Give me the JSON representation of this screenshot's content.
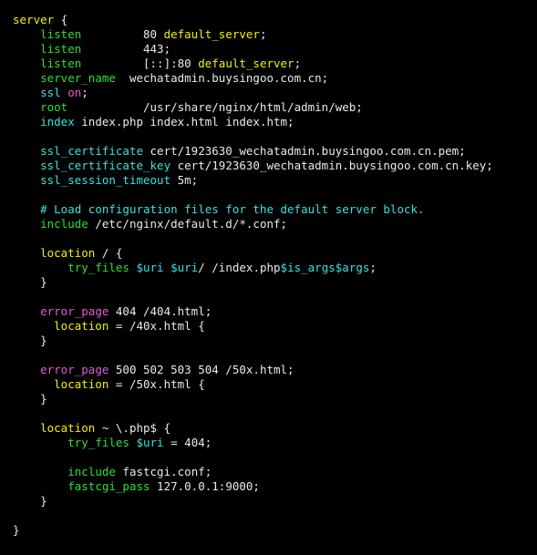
{
  "terminal": {
    "title": "nginx-configuration-file",
    "background_color": "#000000",
    "colors": {
      "plain": "#d8d8d8",
      "yellow": "#f2f200",
      "green": "#2ee02e",
      "cyan": "#3ce0e0",
      "magenta": "#e85ad8",
      "white": "#eaeaea"
    },
    "lines": [
      {
        "id": "line-server-open",
        "tokens": [
          {
            "text": "server",
            "color": "yellow"
          },
          {
            "text": " {",
            "color": "white"
          }
        ]
      },
      {
        "id": "line-listen-80",
        "tokens": [
          {
            "text": "    ",
            "color": "plain"
          },
          {
            "text": "listen",
            "color": "green"
          },
          {
            "text": "         ",
            "color": "plain"
          },
          {
            "text": "80 ",
            "color": "white"
          },
          {
            "text": "default_server",
            "color": "yellow"
          },
          {
            "text": ";",
            "color": "white"
          }
        ]
      },
      {
        "id": "line-listen-443",
        "tokens": [
          {
            "text": "    ",
            "color": "plain"
          },
          {
            "text": "listen",
            "color": "green"
          },
          {
            "text": "         ",
            "color": "plain"
          },
          {
            "text": "443;",
            "color": "white"
          }
        ]
      },
      {
        "id": "line-listen-ipv6",
        "tokens": [
          {
            "text": "    ",
            "color": "plain"
          },
          {
            "text": "listen",
            "color": "green"
          },
          {
            "text": "         ",
            "color": "plain"
          },
          {
            "text": "[::]:80 ",
            "color": "white"
          },
          {
            "text": "default_server",
            "color": "yellow"
          },
          {
            "text": ";",
            "color": "white"
          }
        ]
      },
      {
        "id": "line-server-name",
        "tokens": [
          {
            "text": "    ",
            "color": "plain"
          },
          {
            "text": "server_name",
            "color": "green"
          },
          {
            "text": "  wechatadmin.buysingoo.com.cn;",
            "color": "white"
          }
        ]
      },
      {
        "id": "line-ssl-on",
        "tokens": [
          {
            "text": "    ",
            "color": "plain"
          },
          {
            "text": "ssl",
            "color": "cyan"
          },
          {
            "text": " ",
            "color": "plain"
          },
          {
            "text": "on",
            "color": "magenta"
          },
          {
            "text": ";",
            "color": "white"
          }
        ]
      },
      {
        "id": "line-root",
        "tokens": [
          {
            "text": "    ",
            "color": "plain"
          },
          {
            "text": "root",
            "color": "green"
          },
          {
            "text": "           /usr/share/nginx/html/admin/web;",
            "color": "white"
          }
        ]
      },
      {
        "id": "line-index",
        "tokens": [
          {
            "text": "    ",
            "color": "plain"
          },
          {
            "text": "index",
            "color": "cyan"
          },
          {
            "text": " index.php index.html index.htm;",
            "color": "white"
          }
        ]
      },
      {
        "id": "line-blank-1",
        "tokens": []
      },
      {
        "id": "line-ssl-certificate",
        "tokens": [
          {
            "text": "    ",
            "color": "plain"
          },
          {
            "text": "ssl_certificate",
            "color": "cyan"
          },
          {
            "text": " cert/1923630_wechatadmin.buysingoo.com.cn.pem;",
            "color": "white"
          }
        ]
      },
      {
        "id": "line-ssl-certificate-key",
        "tokens": [
          {
            "text": "    ",
            "color": "plain"
          },
          {
            "text": "ssl_certificate_key",
            "color": "cyan"
          },
          {
            "text": " cert/1923630_wechatadmin.buysingoo.com.cn.key;",
            "color": "white"
          }
        ]
      },
      {
        "id": "line-ssl-session-timeout",
        "tokens": [
          {
            "text": "    ",
            "color": "plain"
          },
          {
            "text": "ssl_session_timeout",
            "color": "cyan"
          },
          {
            "text": " 5m;",
            "color": "white"
          }
        ]
      },
      {
        "id": "line-blank-2",
        "tokens": []
      },
      {
        "id": "line-comment-load-config",
        "tokens": [
          {
            "text": "    ",
            "color": "plain"
          },
          {
            "text": "# Load configuration files for the default server block.",
            "color": "cyan"
          }
        ]
      },
      {
        "id": "line-include-default-d",
        "tokens": [
          {
            "text": "    ",
            "color": "plain"
          },
          {
            "text": "include",
            "color": "green"
          },
          {
            "text": " /etc/nginx/default.d/*.conf;",
            "color": "white"
          }
        ]
      },
      {
        "id": "line-blank-3",
        "tokens": []
      },
      {
        "id": "line-location-root-open",
        "tokens": [
          {
            "text": "    ",
            "color": "plain"
          },
          {
            "text": "location",
            "color": "yellow"
          },
          {
            "text": " / {",
            "color": "white"
          }
        ]
      },
      {
        "id": "line-try-files-root",
        "tokens": [
          {
            "text": "        ",
            "color": "plain"
          },
          {
            "text": "try_files",
            "color": "green"
          },
          {
            "text": " ",
            "color": "plain"
          },
          {
            "text": "$uri",
            "color": "cyan"
          },
          {
            "text": " ",
            "color": "plain"
          },
          {
            "text": "$uri",
            "color": "cyan"
          },
          {
            "text": "/ /index.php",
            "color": "white"
          },
          {
            "text": "$is_args",
            "color": "cyan"
          },
          {
            "text": "$args",
            "color": "cyan"
          },
          {
            "text": ";",
            "color": "white"
          }
        ]
      },
      {
        "id": "line-location-root-close",
        "tokens": [
          {
            "text": "    }",
            "color": "white"
          }
        ]
      },
      {
        "id": "line-blank-4",
        "tokens": []
      },
      {
        "id": "line-error-page-404",
        "tokens": [
          {
            "text": "    ",
            "color": "plain"
          },
          {
            "text": "error_page",
            "color": "magenta"
          },
          {
            "text": " 404 /404.html;",
            "color": "white"
          }
        ]
      },
      {
        "id": "line-location-40x-open",
        "tokens": [
          {
            "text": "      ",
            "color": "plain"
          },
          {
            "text": "location",
            "color": "yellow"
          },
          {
            "text": " = /40x.html {",
            "color": "white"
          }
        ]
      },
      {
        "id": "line-location-40x-close",
        "tokens": [
          {
            "text": "    }",
            "color": "white"
          }
        ]
      },
      {
        "id": "line-blank-5",
        "tokens": []
      },
      {
        "id": "line-error-page-50x",
        "tokens": [
          {
            "text": "    ",
            "color": "plain"
          },
          {
            "text": "error_page",
            "color": "magenta"
          },
          {
            "text": " 500 502 503 504 /50x.html;",
            "color": "white"
          }
        ]
      },
      {
        "id": "line-location-50x-open",
        "tokens": [
          {
            "text": "      ",
            "color": "plain"
          },
          {
            "text": "location",
            "color": "yellow"
          },
          {
            "text": " = /50x.html {",
            "color": "white"
          }
        ]
      },
      {
        "id": "line-location-50x-close",
        "tokens": [
          {
            "text": "    }",
            "color": "white"
          }
        ]
      },
      {
        "id": "line-blank-6",
        "tokens": []
      },
      {
        "id": "line-location-php-open",
        "tokens": [
          {
            "text": "    ",
            "color": "plain"
          },
          {
            "text": "location",
            "color": "yellow"
          },
          {
            "text": " ~ \\.php$ {",
            "color": "white"
          }
        ]
      },
      {
        "id": "line-try-files-php",
        "tokens": [
          {
            "text": "        ",
            "color": "plain"
          },
          {
            "text": "try_files",
            "color": "green"
          },
          {
            "text": " ",
            "color": "plain"
          },
          {
            "text": "$uri",
            "color": "cyan"
          },
          {
            "text": " = 404;",
            "color": "white"
          }
        ]
      },
      {
        "id": "line-blank-7",
        "tokens": []
      },
      {
        "id": "line-include-fastcgi-conf",
        "tokens": [
          {
            "text": "        ",
            "color": "plain"
          },
          {
            "text": "include",
            "color": "green"
          },
          {
            "text": " fastcgi.conf;",
            "color": "white"
          }
        ]
      },
      {
        "id": "line-fastcgi-pass",
        "tokens": [
          {
            "text": "        ",
            "color": "plain"
          },
          {
            "text": "fastcgi_pass",
            "color": "green"
          },
          {
            "text": " 127.0.0.1:9000;",
            "color": "white"
          }
        ]
      },
      {
        "id": "line-location-php-close",
        "tokens": [
          {
            "text": "    }",
            "color": "white"
          }
        ]
      },
      {
        "id": "line-blank-8",
        "tokens": []
      },
      {
        "id": "line-server-close",
        "tokens": [
          {
            "text": "}",
            "color": "white"
          }
        ]
      }
    ]
  }
}
